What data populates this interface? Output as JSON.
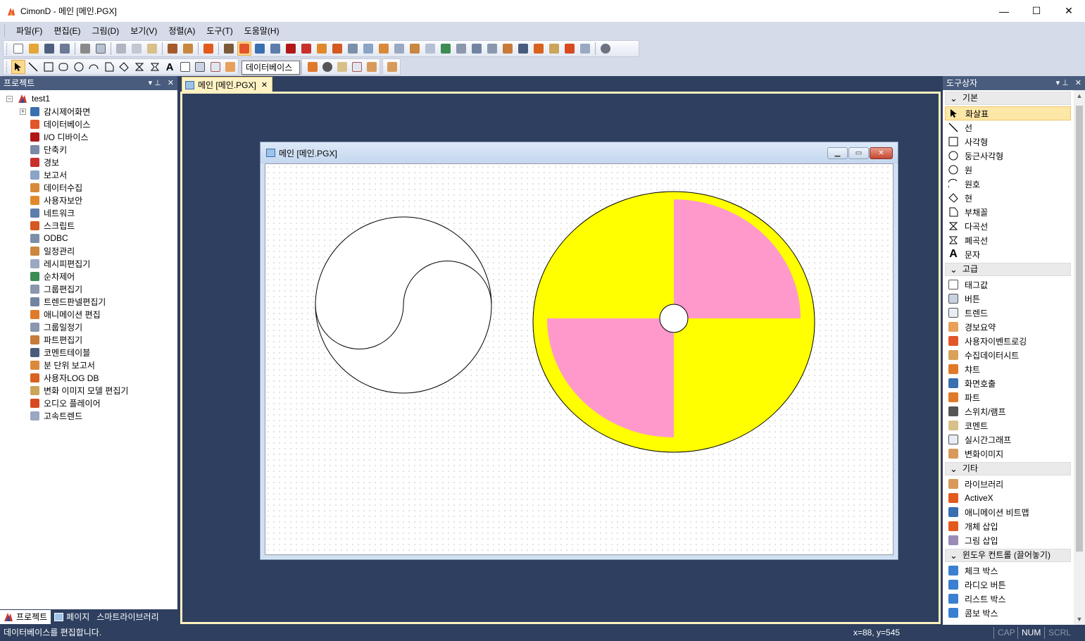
{
  "window": {
    "title": "CimonD - 메인 [메인.PGX]",
    "minimize_glyph": "—",
    "maximize_glyph": "☐",
    "close_glyph": "✕"
  },
  "menu": [
    "파일(F)",
    "편집(E)",
    "그림(D)",
    "보기(V)",
    "정렬(A)",
    "도구(T)",
    "도움말(H)"
  ],
  "toolbar_tooltip": "데이터베이스",
  "left_panel": {
    "title": "프로젝트",
    "pin": "▾  ⊥",
    "close": "✕",
    "root": "test1",
    "root_expander": "−",
    "screen_expander": "+",
    "items": [
      {
        "label": "감시제어화면",
        "icon": "monitor-screen-icon",
        "color": "#3a6fb0"
      },
      {
        "label": "데이터베이스",
        "icon": "database-pencil-icon",
        "color": "#e2562a"
      },
      {
        "label": "I/O 디바이스",
        "icon": "io-device-icon",
        "color": "#b01818"
      },
      {
        "label": "단축키",
        "icon": "shortcut-key-icon",
        "color": "#7a8aa8"
      },
      {
        "label": "경보",
        "icon": "alarm-icon",
        "color": "#c9302c"
      },
      {
        "label": "보고서",
        "icon": "report-icon",
        "color": "#8aa4c8"
      },
      {
        "label": "데이터수집",
        "icon": "data-collection-icon",
        "color": "#d88a3a"
      },
      {
        "label": "사용자보안",
        "icon": "user-security-icon",
        "color": "#e0892a"
      },
      {
        "label": "네트워크",
        "icon": "network-icon",
        "color": "#5d7dac"
      },
      {
        "label": "스크립트",
        "icon": "script-icon",
        "color": "#d45a22"
      },
      {
        "label": "ODBC",
        "icon": "odbc-icon",
        "color": "#7b8fa8"
      },
      {
        "label": "일정관리",
        "icon": "schedule-icon",
        "color": "#c9873f"
      },
      {
        "label": "레시피편집기",
        "icon": "recipe-editor-icon",
        "color": "#9aa9c2"
      },
      {
        "label": "순차제어",
        "icon": "sequence-control-icon",
        "color": "#3c8c54"
      },
      {
        "label": "그룹편집기",
        "icon": "group-editor-icon",
        "color": "#8a97ad"
      },
      {
        "label": "트렌드판넬편집기",
        "icon": "trend-panel-icon",
        "color": "#7384a2"
      },
      {
        "label": "애니메이션 편집",
        "icon": "animation-icon",
        "color": "#e07a2a"
      },
      {
        "label": "그룹일정기",
        "icon": "group-schedule-icon",
        "color": "#8a97ad"
      },
      {
        "label": "파트편집기",
        "icon": "part-editor-icon",
        "color": "#c67b3a"
      },
      {
        "label": "코멘트테이블",
        "icon": "comment-table-icon",
        "color": "#4a5c7e"
      },
      {
        "label": "분 단위 보고서",
        "icon": "minute-report-icon",
        "color": "#d98a3a"
      },
      {
        "label": "사용자LOG DB",
        "icon": "user-log-db-icon",
        "color": "#d8631f"
      },
      {
        "label": "변화 이미지 모델 편집기",
        "icon": "image-model-icon",
        "color": "#caa55a"
      },
      {
        "label": "오디오 플레이어",
        "icon": "audio-player-icon",
        "color": "#d84a1f"
      },
      {
        "label": "고속트렌드",
        "icon": "fast-trend-icon",
        "color": "#9aa9c2"
      }
    ],
    "tabs": [
      {
        "label": "프로젝트",
        "icon": "project-icon"
      },
      {
        "label": "페이지",
        "icon": "page-icon"
      },
      {
        "label": "스마트라이브러리",
        "icon": ""
      }
    ]
  },
  "doc_tab": {
    "label": "메인 [메인.PGX]",
    "close": "✕"
  },
  "child_window": {
    "title": "메인 [메인.PGX]",
    "min_glyph": "▁",
    "max_glyph": "▭",
    "close_glyph": "✕"
  },
  "colors": {
    "disc_yellow": "#ffff00",
    "disc_pink": "#ff99cc",
    "panel_header": "#4a5c7e",
    "background": "#2e3f5f"
  },
  "right_panel": {
    "title": "도구상자",
    "groups": [
      {
        "label": "기본",
        "items": [
          {
            "label": "화살표",
            "icon": "arrow-pointer-icon",
            "selected": true
          },
          {
            "label": "선",
            "icon": "line-icon"
          },
          {
            "label": "사각형",
            "icon": "rectangle-icon"
          },
          {
            "label": "둥근사각형",
            "icon": "rounded-rectangle-icon"
          },
          {
            "label": "원",
            "icon": "circle-icon"
          },
          {
            "label": "원호",
            "icon": "arc-icon"
          },
          {
            "label": "현",
            "icon": "chord-icon"
          },
          {
            "label": "부채꼴",
            "icon": "sector-icon"
          },
          {
            "label": "다곡선",
            "icon": "polycurve-icon"
          },
          {
            "label": "폐곡선",
            "icon": "closed-curve-icon"
          },
          {
            "label": "문자",
            "icon": "text-icon"
          }
        ]
      },
      {
        "label": "고급",
        "items": [
          {
            "label": "태그값",
            "icon": "tag-value-icon"
          },
          {
            "label": "버튼",
            "icon": "button-icon"
          },
          {
            "label": "트렌드",
            "icon": "trend-icon"
          },
          {
            "label": "경보요약",
            "icon": "alarm-summary-icon"
          },
          {
            "label": "사용자이벤트로깅",
            "icon": "user-event-log-icon"
          },
          {
            "label": "수집데이터시트",
            "icon": "data-sheet-icon"
          },
          {
            "label": "챠트",
            "icon": "chart-icon"
          },
          {
            "label": "화면호출",
            "icon": "screen-call-icon"
          },
          {
            "label": "파트",
            "icon": "part-icon"
          },
          {
            "label": "스위치/램프",
            "icon": "switch-lamp-icon"
          },
          {
            "label": "코멘트",
            "icon": "comment-icon"
          },
          {
            "label": "실시간그래프",
            "icon": "realtime-graph-icon"
          },
          {
            "label": "변화이미지",
            "icon": "change-image-icon"
          }
        ]
      },
      {
        "label": "기타",
        "items": [
          {
            "label": "라이브러리",
            "icon": "library-icon"
          },
          {
            "label": "ActiveX",
            "icon": "activex-icon"
          },
          {
            "label": "애니메이션 비트맵",
            "icon": "animation-bitmap-icon"
          },
          {
            "label": "개체 삽입",
            "icon": "object-insert-icon"
          },
          {
            "label": "그림 삽입",
            "icon": "picture-insert-icon"
          }
        ]
      },
      {
        "label": "윈도우 컨트롤 (끌어놓기)",
        "items": [
          {
            "label": "체크 박스",
            "icon": "checkbox-icon"
          },
          {
            "label": "라디오 버튼",
            "icon": "radio-button-icon"
          },
          {
            "label": "리스트 박스",
            "icon": "list-box-icon"
          },
          {
            "label": "콤보 박스",
            "icon": "combo-box-icon"
          }
        ]
      }
    ]
  },
  "status": {
    "message": "데이터베이스를 편집합니다.",
    "coords": "x=88, y=545",
    "cap": "CAP",
    "num": "NUM",
    "scrl": "SCRL"
  }
}
